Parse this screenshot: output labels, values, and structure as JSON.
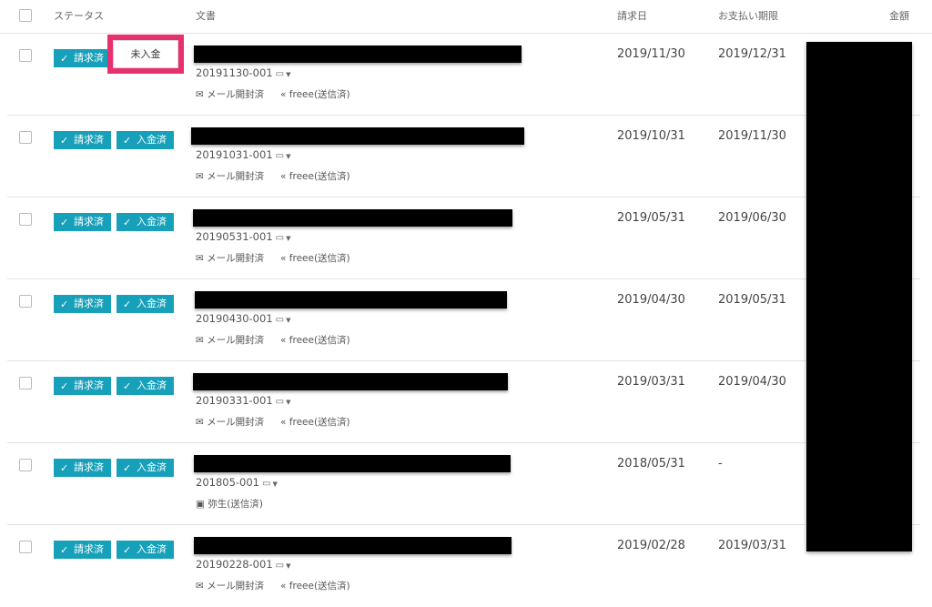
{
  "header": {
    "status": "ステータス",
    "document": "文書",
    "invoice_date": "請求日",
    "due_date": "お支払い期限",
    "amount": "金額"
  },
  "icons": {
    "check": "check-icon",
    "comment": "comment-icon",
    "caret": "caret-down-icon",
    "mail": "envelope-open-icon",
    "send": "send-icon",
    "file": "file-icon"
  },
  "colors": {
    "badge": "#17a0b9",
    "highlight": "#e8306e"
  },
  "rows": [
    {
      "status1": "請求済",
      "status2": "未入金",
      "doc_no": "20191130-001",
      "meta1": "メール開封済",
      "meta2": "freee(送信済)",
      "invoice_date": "2019/11/30",
      "due_date": "2019/12/31"
    },
    {
      "status1": "請求済",
      "status2": "入金済",
      "doc_no": "20191031-001",
      "meta1": "メール開封済",
      "meta2": "freee(送信済)",
      "invoice_date": "2019/10/31",
      "due_date": "2019/11/30"
    },
    {
      "status1": "請求済",
      "status2": "入金済",
      "doc_no": "20190531-001",
      "meta1": "メール開封済",
      "meta2": "freee(送信済)",
      "invoice_date": "2019/05/31",
      "due_date": "2019/06/30"
    },
    {
      "status1": "請求済",
      "status2": "入金済",
      "doc_no": "20190430-001",
      "meta1": "メール開封済",
      "meta2": "freee(送信済)",
      "invoice_date": "2019/04/30",
      "due_date": "2019/05/31"
    },
    {
      "status1": "請求済",
      "status2": "入金済",
      "doc_no": "20190331-001",
      "meta1": "メール開封済",
      "meta2": "freee(送信済)",
      "invoice_date": "2019/03/31",
      "due_date": "2019/04/30"
    },
    {
      "status1": "請求済",
      "status2": "入金済",
      "doc_no": "201805-001",
      "meta1": "弥生(送信済)",
      "meta2": "",
      "invoice_date": "2018/05/31",
      "due_date": "-"
    },
    {
      "status1": "請求済",
      "status2": "入金済",
      "doc_no": "20190228-001",
      "meta1": "メール開封済",
      "meta2": "freee(送信済)",
      "invoice_date": "2019/02/28",
      "due_date": "2019/03/31"
    }
  ]
}
